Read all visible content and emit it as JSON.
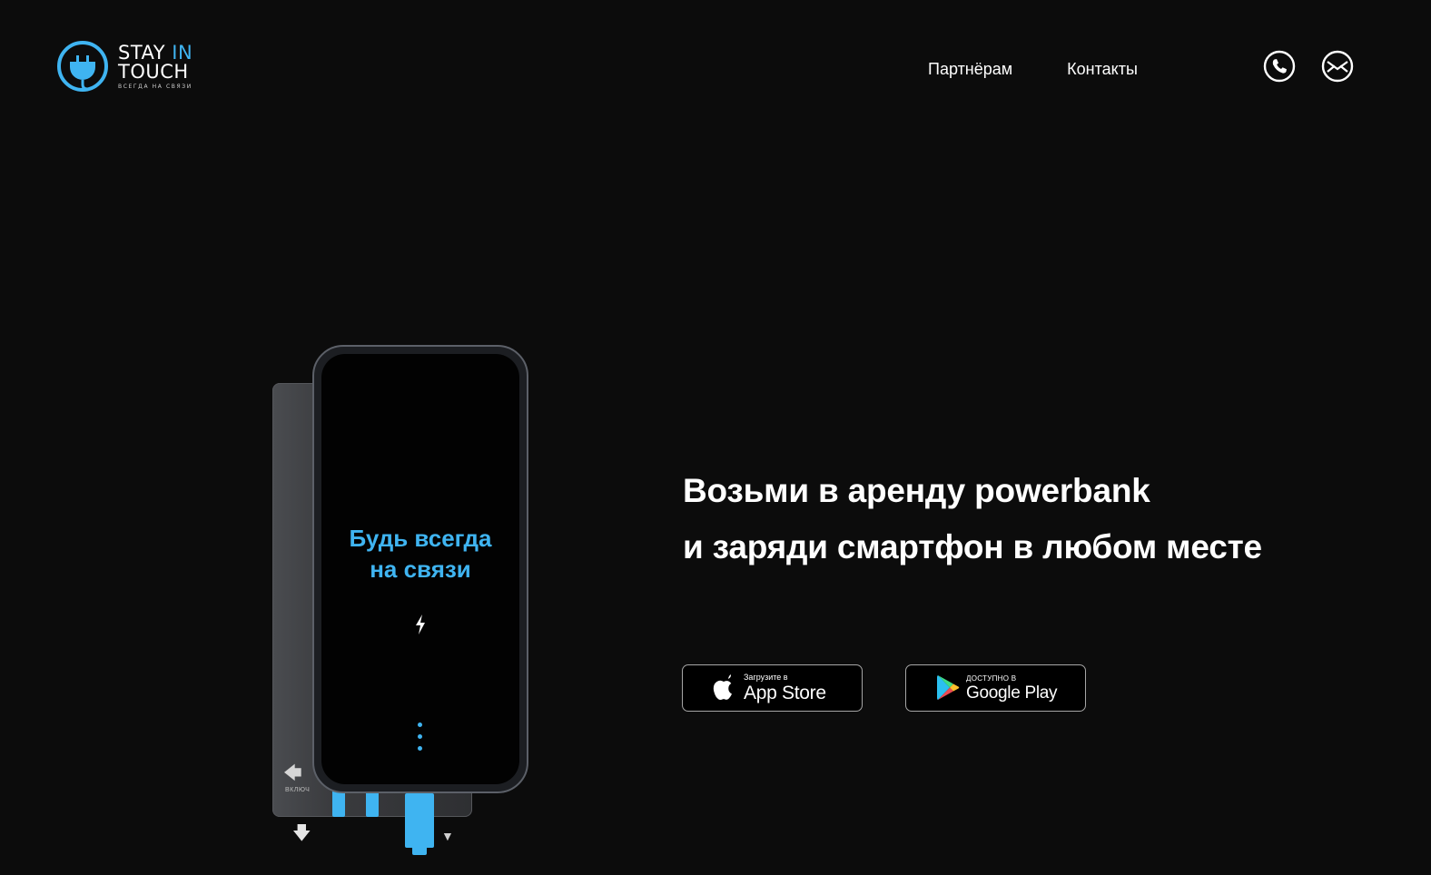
{
  "header": {
    "logo": {
      "line1_part1": "STAY ",
      "line1_part2": "IN",
      "line2": "TOUCH",
      "subtitle": "ВСЕГДА НА СВЯЗИ"
    },
    "nav": [
      {
        "label": "Партнёрам"
      },
      {
        "label": "Контакты"
      }
    ],
    "contact_icons": [
      "phone-icon",
      "mail-icon"
    ]
  },
  "hero": {
    "phone_screen": {
      "tagline_line1": "Будь всегда",
      "tagline_line2": "на связи"
    },
    "station_label": "ВКЛЮЧ",
    "headline_line1": "Возьми в аренду powerbank",
    "headline_line2": "и заряди смартфон в любом месте"
  },
  "badges": {
    "appstore": {
      "small": "Загрузите в",
      "big": "App Store"
    },
    "gplay": {
      "small": "ДОСТУПНО В",
      "big": "Google Play"
    }
  },
  "colors": {
    "background": "#0c0c0c",
    "accent": "#3fb4f1",
    "text": "#ffffff"
  }
}
